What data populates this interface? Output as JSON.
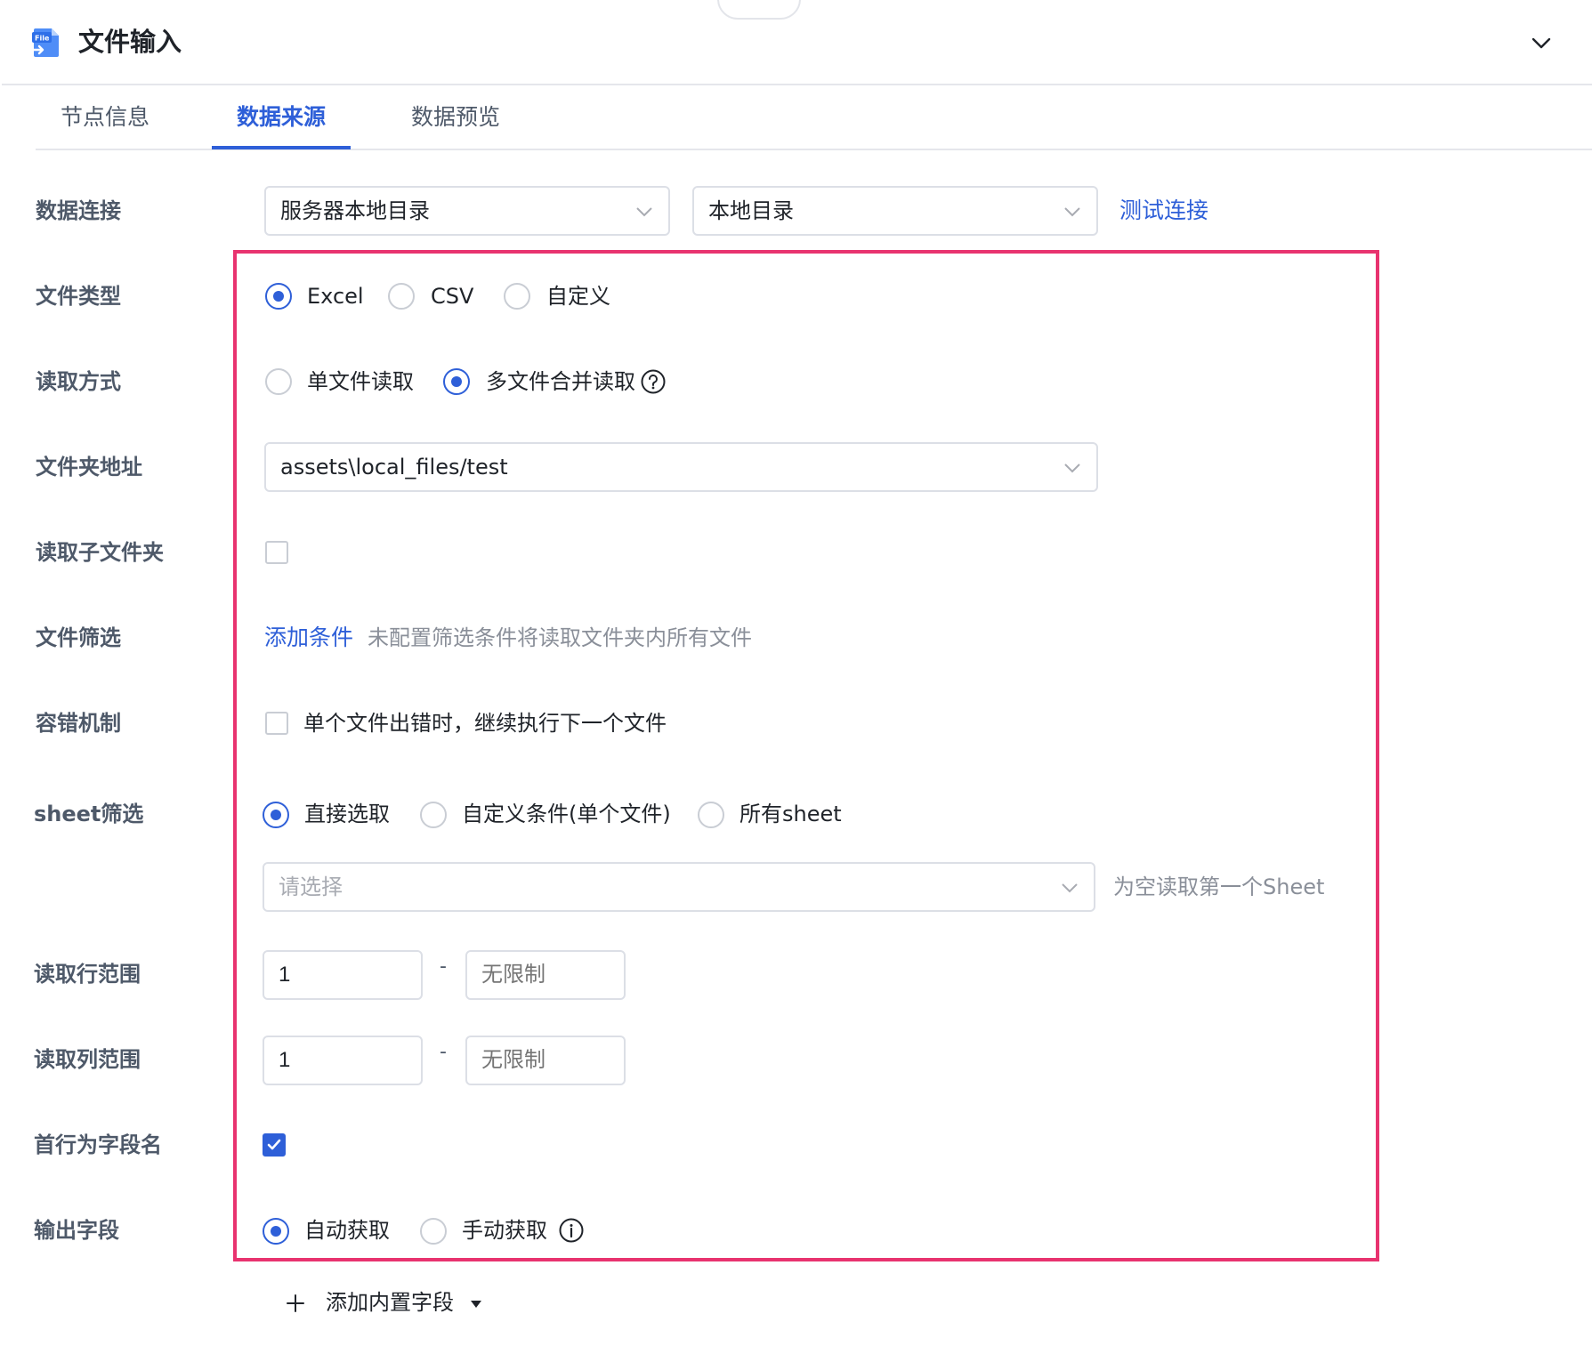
{
  "header": {
    "title": "文件输入",
    "icon": "file-input-icon",
    "icon_badge": "File",
    "collapse_icon": "chevron-down-icon"
  },
  "tabs": [
    {
      "label": "节点信息",
      "active": false
    },
    {
      "label": "数据来源",
      "active": true
    },
    {
      "label": "数据预览",
      "active": false
    }
  ],
  "form": {
    "connection": {
      "label": "数据连接",
      "source_value": "服务器本地目录",
      "target_value": "本地目录",
      "test_link": "测试连接"
    },
    "file_type": {
      "label": "文件类型",
      "options": [
        "Excel",
        "CSV",
        "自定义"
      ],
      "selected": "Excel"
    },
    "read_mode": {
      "label": "读取方式",
      "options": [
        "单文件读取",
        "多文件合并读取"
      ],
      "selected": "多文件合并读取"
    },
    "folder_path": {
      "label": "文件夹地址",
      "value": "assets\\local_files/test"
    },
    "read_subfolders": {
      "label": "读取子文件夹",
      "checked": false
    },
    "file_filter": {
      "label": "文件筛选",
      "add_link": "添加条件",
      "hint": "未配置筛选条件将读取文件夹内所有文件"
    },
    "fault_tolerance": {
      "label": "容错机制",
      "option_text": "单个文件出错时，继续执行下一个文件",
      "checked": false
    },
    "sheet_filter": {
      "label": "sheet筛选",
      "options": [
        "直接选取",
        "自定义条件(单个文件)",
        "所有sheet"
      ],
      "selected": "直接选取",
      "select_placeholder": "请选择",
      "hint": "为空读取第一个Sheet"
    },
    "row_range": {
      "label": "读取行范围",
      "start": "1",
      "separator": "-",
      "end_placeholder": "无限制"
    },
    "col_range": {
      "label": "读取列范围",
      "start": "1",
      "separator": "-",
      "end_placeholder": "无限制"
    },
    "first_row_header": {
      "label": "首行为字段名",
      "checked": true
    },
    "output_fields": {
      "label": "输出字段",
      "options": [
        "自动获取",
        "手动获取"
      ],
      "selected": "自动获取"
    },
    "add_builtin_field": "添加内置字段"
  },
  "colors": {
    "accent": "#2e5fd8",
    "highlight_border": "#e8336f"
  }
}
